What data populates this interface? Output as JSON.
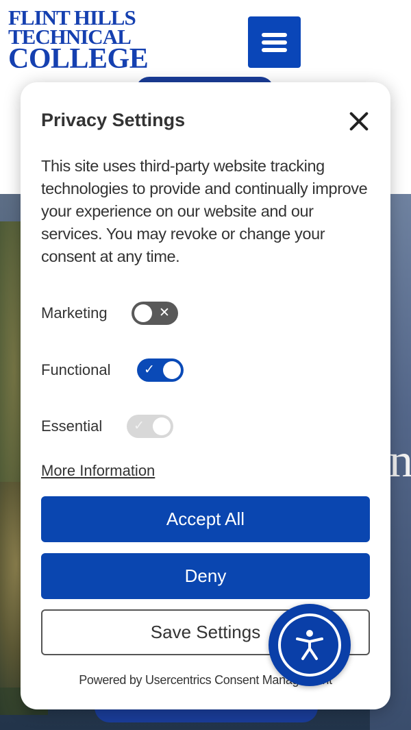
{
  "site": {
    "logo_line1": "FLINT HILLS",
    "logo_line2": "TECHNICAL",
    "logo_line3": "COLLEGE",
    "menu_icon": "hamburger-icon",
    "hero_letter": "n",
    "brand_color": "#0a46b0"
  },
  "consent": {
    "title": "Privacy Settings",
    "description": "This site uses third-party website tracking technologies to provide and continually improve your experience on our website and our services. You may revoke or change your consent at any time.",
    "categories": [
      {
        "label": "Marketing",
        "state": "off"
      },
      {
        "label": "Functional",
        "state": "on"
      },
      {
        "label": "Essential",
        "state": "on-disabled"
      }
    ],
    "more_info": "More Information",
    "accept_all": "Accept All",
    "deny": "Deny",
    "save_settings": "Save Settings",
    "powered_by": "Powered by Usercentrics Consent Management",
    "close_icon": "close-icon"
  },
  "accessibility": {
    "icon": "accessibility-icon"
  }
}
